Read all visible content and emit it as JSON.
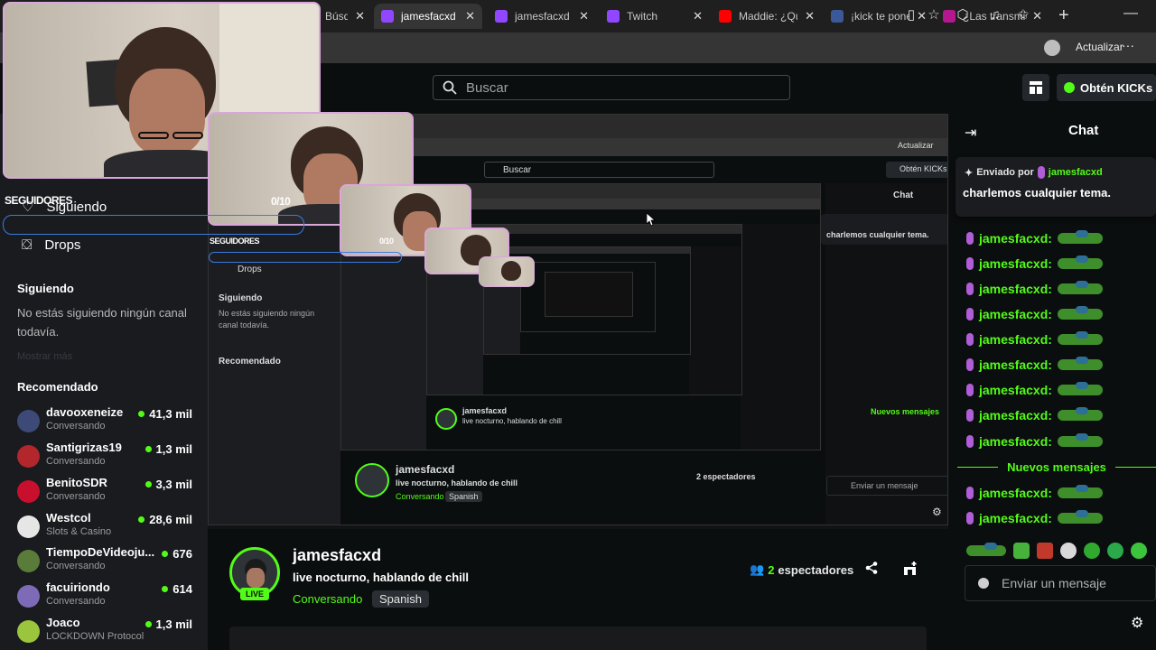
{
  "browser": {
    "tabs": [
      {
        "label": "Búsqueda",
        "favicon_color": "#e8e8e8",
        "active": false
      },
      {
        "label": "jamesfacxd - Twitch",
        "favicon_color": "#9146ff",
        "active": true
      },
      {
        "label": "jamesfacxd - Twitch",
        "favicon_color": "#9146ff",
        "active": false
      },
      {
        "label": "Twitch",
        "favicon_color": "#9146ff",
        "active": false
      },
      {
        "label": "Maddie: ¿Qué opinas?",
        "favicon_color": "#ff0000",
        "active": false
      },
      {
        "label": "¡kick te pone bien!",
        "favicon_color": "#3b5998",
        "active": false
      },
      {
        "label": "¿Las transmisiones",
        "favicon_color": "#b5178f",
        "active": false
      }
    ],
    "update_label": "Actualizar",
    "new_tab_icon": "plus-icon"
  },
  "header": {
    "search_placeholder": "Buscar",
    "kicks_label": "Obtén KICKs"
  },
  "sidebar": {
    "following_nav": "Siguiendo",
    "drops_nav": "Drops",
    "following_heading": "Siguiendo",
    "no_following_text": "No estás siguiendo ningún canal todavía.",
    "show_more": "Mostrar más",
    "recommended_heading": "Recomendado",
    "recommended": [
      {
        "name": "davooxeneize",
        "category": "Conversando",
        "viewers": "41,3 mil",
        "color": "#3d4a78"
      },
      {
        "name": "Santigrizas19",
        "category": "Conversando",
        "viewers": "1,3 mil",
        "color": "#b3262c"
      },
      {
        "name": "BenitoSDR",
        "category": "Conversando",
        "viewers": "3,3 mil",
        "color": "#c8102e"
      },
      {
        "name": "Westcol",
        "category": "Slots & Casino",
        "viewers": "28,6 mil",
        "color": "#e6e6e6"
      },
      {
        "name": "TiempoDeVideoju...",
        "category": "Conversando",
        "viewers": "676",
        "color": "#5a7c3a"
      },
      {
        "name": "facuiriondo",
        "category": "Conversando",
        "viewers": "614",
        "color": "#7d6bb7"
      },
      {
        "name": "Joaco",
        "category": "LOCKDOWN Protocol",
        "viewers": "1,3 mil",
        "color": "#9bc53d"
      }
    ]
  },
  "overlay": {
    "seguidores_label": "SEGUIDORES",
    "counter": "0/10"
  },
  "stream": {
    "channel": "jamesfacxd",
    "title": "live nocturno, hablando de chill",
    "category": "Conversando",
    "language": "Spanish",
    "live_badge": "LIVE",
    "viewers_count": "2",
    "viewers_label": "espectadores"
  },
  "chat": {
    "title": "Chat",
    "pinned_by_label": "Enviado por",
    "pinned_user": "jamesfacxd",
    "pinned_message": "charlemos cualquier tema.",
    "messages": [
      {
        "user": "jamesfacxd:"
      },
      {
        "user": "jamesfacxd:"
      },
      {
        "user": "jamesfacxd:"
      },
      {
        "user": "jamesfacxd:"
      },
      {
        "user": "jamesfacxd:"
      },
      {
        "user": "jamesfacxd:"
      },
      {
        "user": "jamesfacxd:"
      },
      {
        "user": "jamesfacxd:"
      },
      {
        "user": "jamesfacxd:"
      },
      {
        "user": "jamesfacxd:"
      },
      {
        "user": "jamesfacxd:"
      }
    ],
    "new_messages_label": "Nuevos mensajes",
    "input_placeholder": "Enviar un mensaje"
  },
  "nested": {
    "search_placeholder": "Buscar",
    "kicks_label": "Obtén KICKs",
    "chat_title": "Chat",
    "channel": "jamesfacxd",
    "title": "live nocturno, hablando de chill",
    "category": "Conversando",
    "language": "Spanish",
    "viewers": "2 espectadores",
    "input_placeholder": "Enviar un mensaje",
    "pinned_message": "charlemos cualquier tema.",
    "following_nav": "Siguiendo",
    "drops_nav": "Drops",
    "following_heading": "Siguiendo",
    "no_following_text": "No estás siguiendo ningún canal todavía.",
    "recommended_heading": "Recomendado",
    "new_messages_label": "Nuevos mensajes",
    "update_label": "Actualizar"
  },
  "colors": {
    "accent": "#53fc18",
    "background": "#0b0e0f",
    "sidebar": "#191b1f",
    "username_icon": "#b05dd8"
  }
}
